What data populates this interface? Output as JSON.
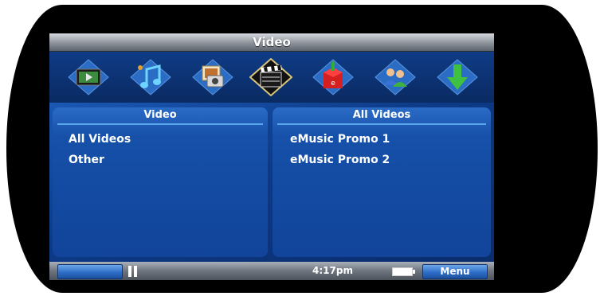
{
  "window": {
    "title": "Video"
  },
  "iconbar": {
    "icons": [
      {
        "name": "tv-video-icon"
      },
      {
        "name": "music-notes-icon"
      },
      {
        "name": "photos-camera-icon"
      },
      {
        "name": "clapperboard-icon",
        "selected": true
      },
      {
        "name": "gift-store-icon"
      },
      {
        "name": "users-icon"
      },
      {
        "name": "download-icon"
      }
    ]
  },
  "left_panel": {
    "title": "Video",
    "items": [
      "All Videos",
      "Other"
    ]
  },
  "right_panel": {
    "title": "All Videos",
    "items": [
      "eMusic Promo 1",
      "eMusic Promo 2"
    ]
  },
  "statusbar": {
    "time": "4:17pm",
    "menu_label": "Menu"
  },
  "colors": {
    "accent": "#1650a8",
    "selected_icon_frame": "#d8c37a"
  }
}
